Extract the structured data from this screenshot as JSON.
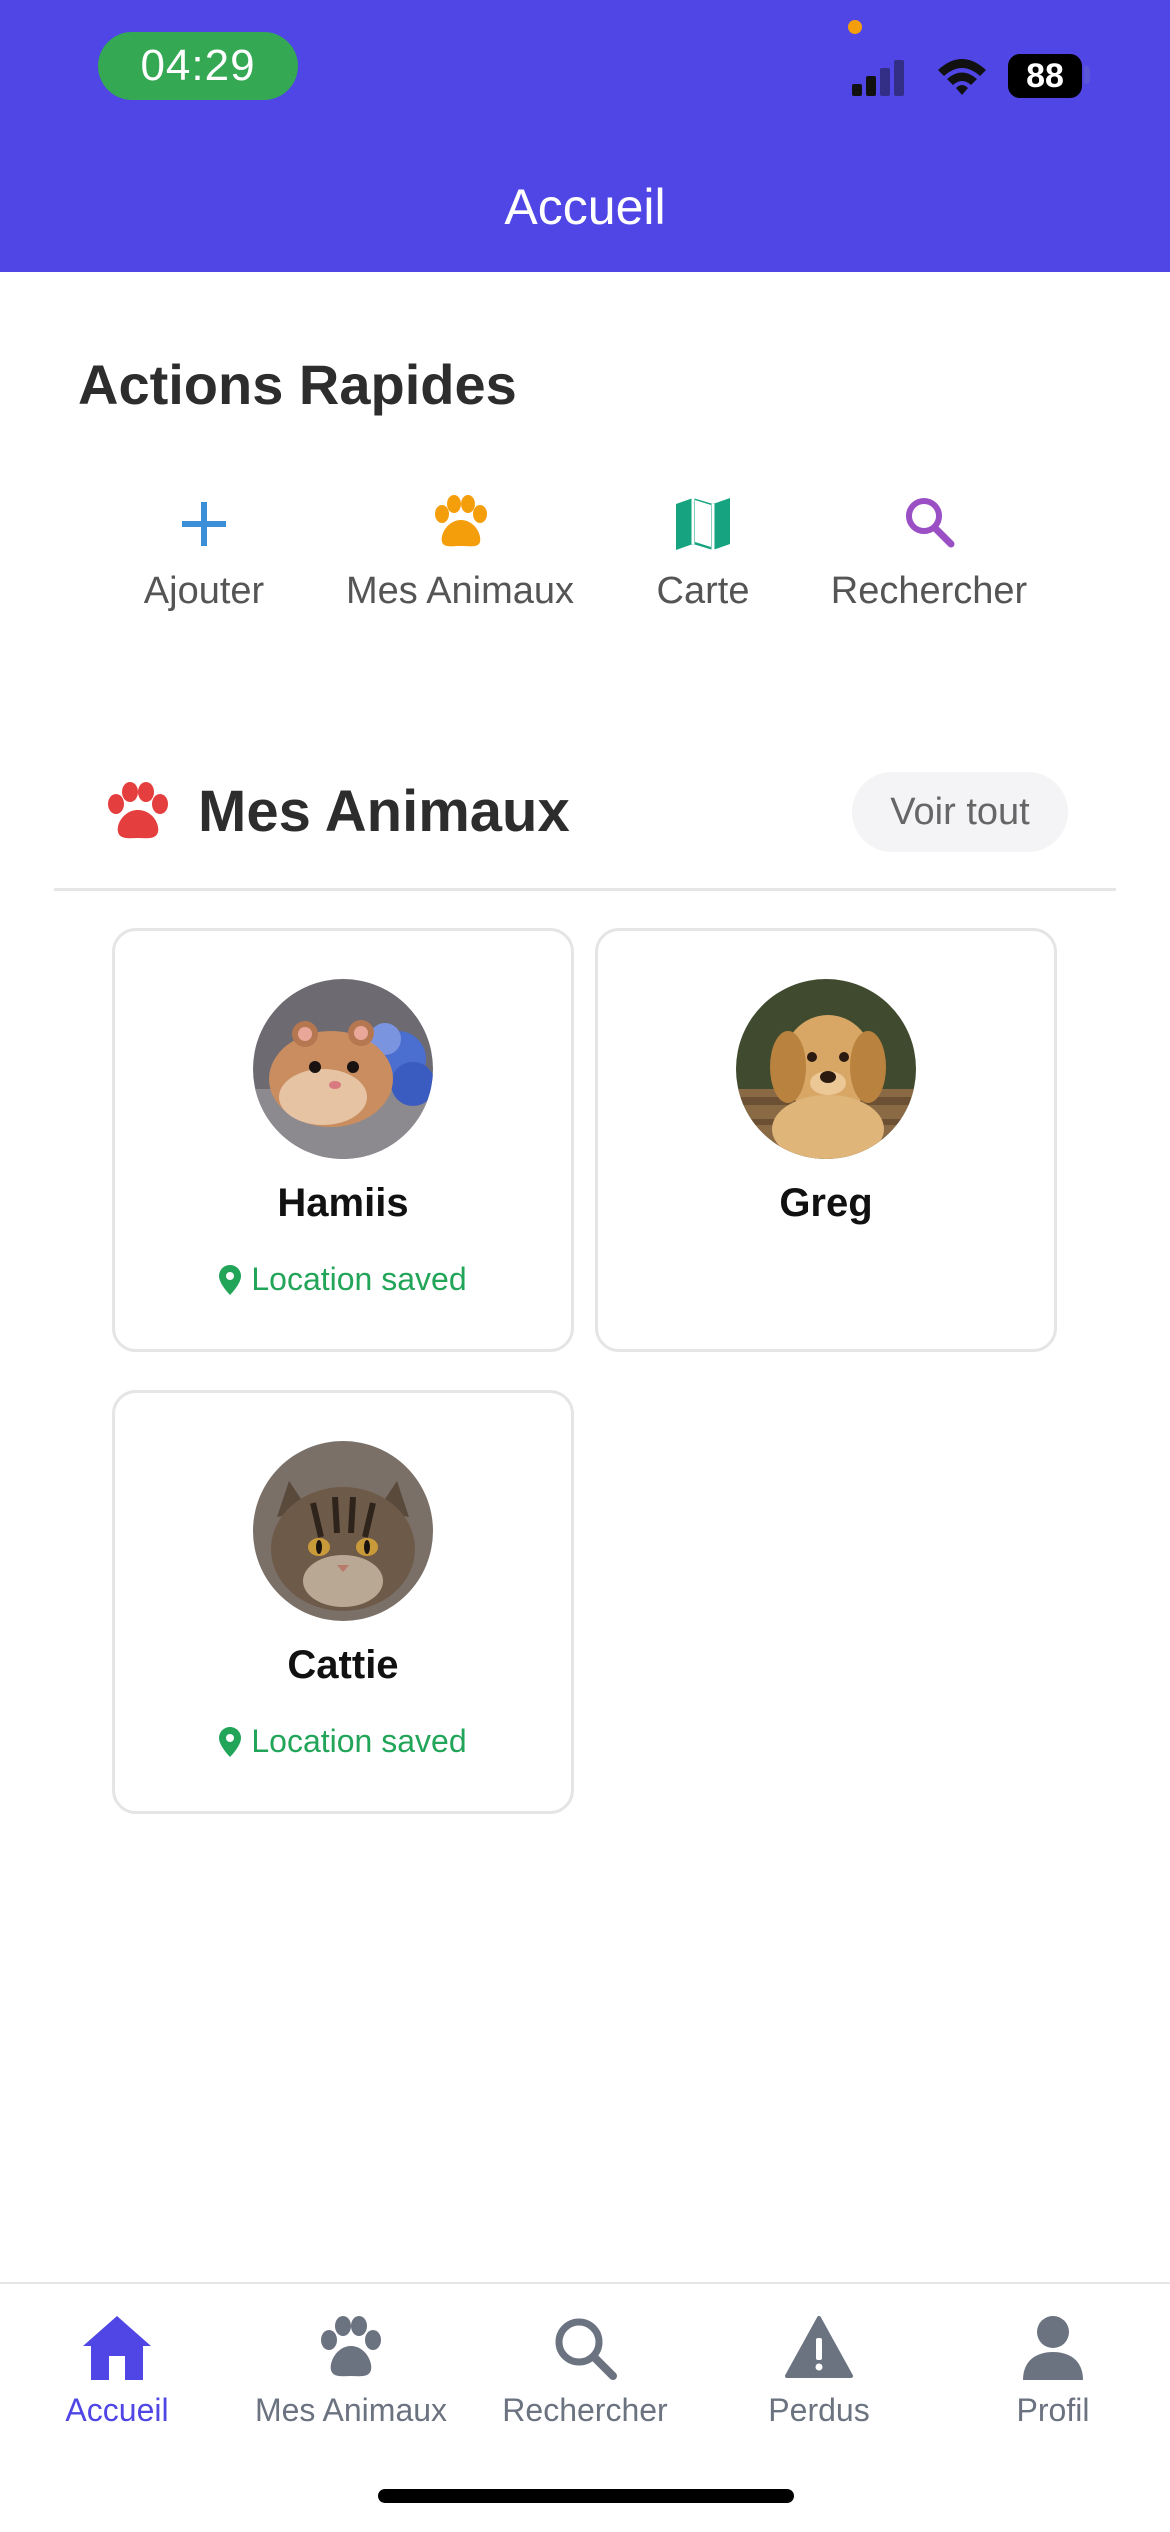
{
  "status_bar": {
    "time": "04:29",
    "battery": "88"
  },
  "header": {
    "title": "Accueil"
  },
  "quick_actions": {
    "title": "Actions Rapides",
    "items": [
      {
        "label": "Ajouter",
        "icon": "plus-icon",
        "color": "#3B8FD9"
      },
      {
        "label": "Mes Animaux",
        "icon": "paw-icon",
        "color": "#F59E0B"
      },
      {
        "label": "Carte",
        "icon": "map-icon",
        "color": "#16A37F"
      },
      {
        "label": "Rechercher",
        "icon": "search-icon",
        "color": "#9B4FC4"
      }
    ]
  },
  "pets_section": {
    "title": "Mes Animaux",
    "icon_color": "#E53E3E",
    "see_all_label": "Voir tout",
    "pets": [
      {
        "name": "Hamiis",
        "location": "Location saved",
        "avatar": "hamster-photo"
      },
      {
        "name": "Greg",
        "location": "",
        "avatar": "dog-photo"
      },
      {
        "name": "Cattie",
        "location": "Location saved",
        "avatar": "cat-photo"
      }
    ]
  },
  "bottom_nav": {
    "active_color": "#4F46E5",
    "inactive_color": "#6B7280",
    "items": [
      {
        "label": "Accueil",
        "icon": "home-icon",
        "active": true
      },
      {
        "label": "Mes Animaux",
        "icon": "paw-icon",
        "active": false
      },
      {
        "label": "Rechercher",
        "icon": "search-icon",
        "active": false
      },
      {
        "label": "Perdus",
        "icon": "warning-icon",
        "active": false
      },
      {
        "label": "Profil",
        "icon": "user-icon",
        "active": false
      }
    ]
  }
}
